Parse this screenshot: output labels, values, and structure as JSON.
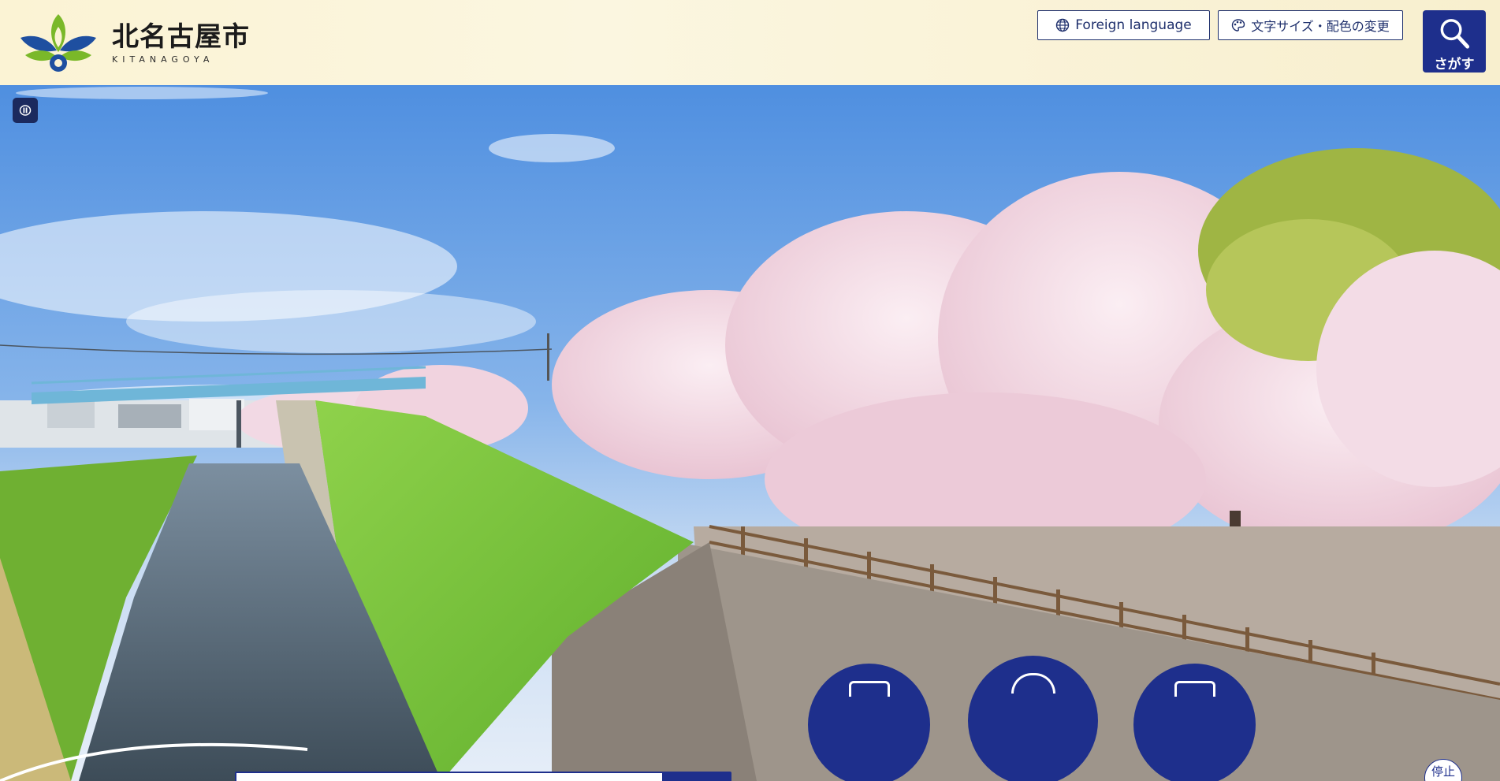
{
  "header": {
    "logo_kanji": "北名古屋市",
    "logo_roman": "KITANAGOYA",
    "foreign_language_label": "Foreign language",
    "font_size_label": "文字サイズ・配色の変更",
    "search_label": "さがす"
  },
  "hero": {
    "stop_label": "停止"
  },
  "colors": {
    "brand_navy": "#1e2f8c",
    "header_bg": "#fbf3d4",
    "sky": "#6fa6e6",
    "blossom": "#f3dbe6",
    "grass": "#7cc83e",
    "logo_green": "#7ab829",
    "logo_blue": "#1e4fa0"
  },
  "icons": {
    "foreign": "globe-icon",
    "font_size": "palette-icon",
    "search": "magnifier-icon",
    "pause": "pause-icon"
  }
}
